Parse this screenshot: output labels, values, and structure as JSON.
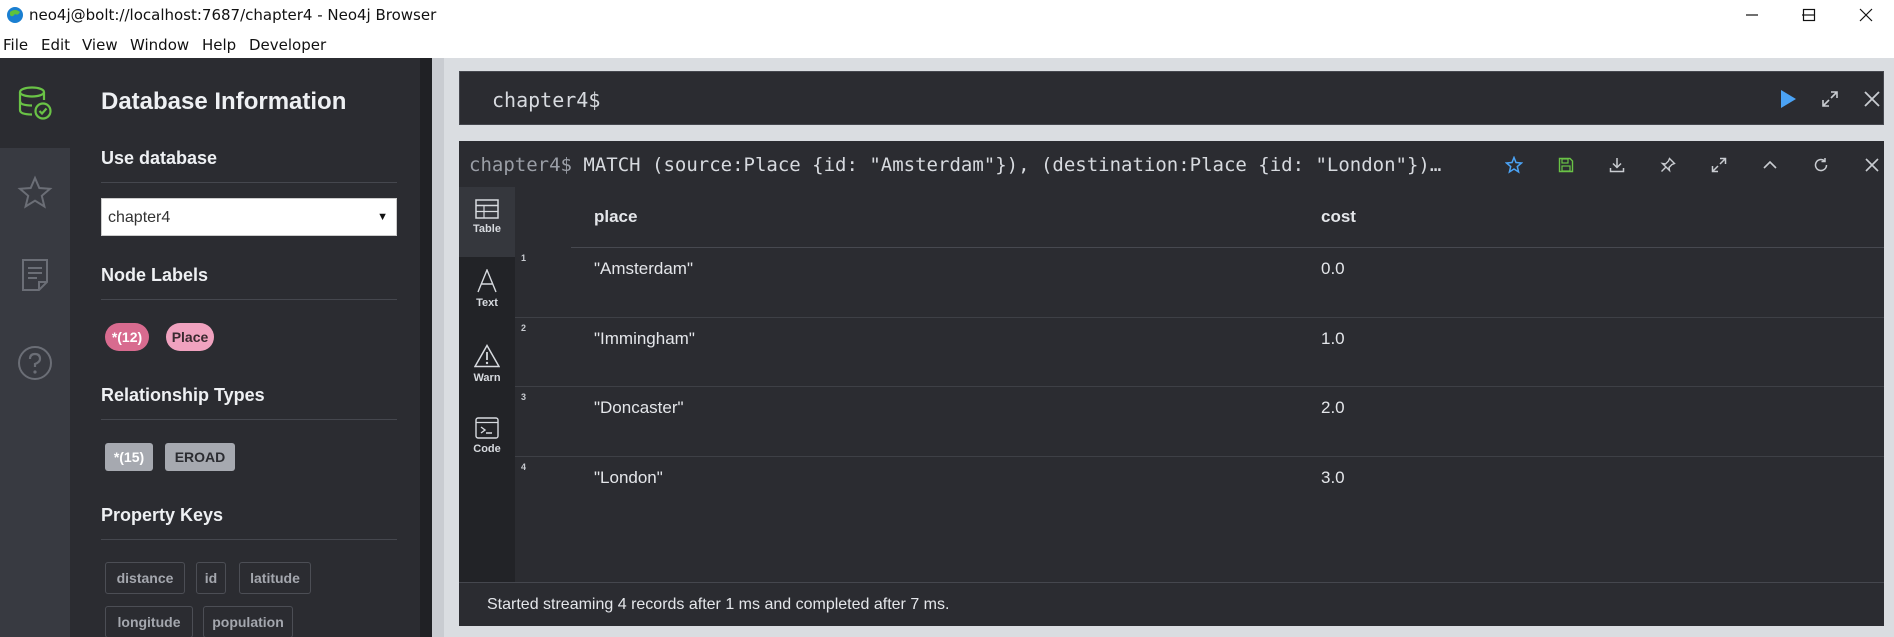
{
  "window": {
    "title": "neo4j@bolt://localhost:7687/chapter4 - Neo4j Browser"
  },
  "menu": [
    "File",
    "Edit",
    "View",
    "Window",
    "Help",
    "Developer"
  ],
  "iconbar": {
    "items": [
      "database-icon",
      "star-icon",
      "document-icon",
      "help-icon"
    ]
  },
  "drawer": {
    "title": "Database Information",
    "use_database": {
      "heading": "Use database",
      "selected": "chapter4"
    },
    "node_labels": {
      "heading": "Node Labels",
      "items": [
        "*(12)",
        "Place"
      ]
    },
    "relationship_types": {
      "heading": "Relationship Types",
      "items": [
        "*(15)",
        "EROAD"
      ]
    },
    "property_keys": {
      "heading": "Property Keys",
      "items": [
        "distance",
        "id",
        "latitude",
        "longitude",
        "population"
      ]
    }
  },
  "editor": {
    "prompt": "chapter4$"
  },
  "frame": {
    "prompt": "chapter4$",
    "query": " MATCH (source:Place {id: \"Amsterdam\"}), (destination:Place {id: \"London\"})…",
    "views": [
      "Table",
      "Text",
      "Warn",
      "Code"
    ],
    "columns": [
      "place",
      "cost"
    ],
    "rows": [
      {
        "num": "1",
        "place": "\"Amsterdam\"",
        "cost": "0.0"
      },
      {
        "num": "2",
        "place": "\"Immingham\"",
        "cost": "1.0"
      },
      {
        "num": "3",
        "place": "\"Doncaster\"",
        "cost": "2.0"
      },
      {
        "num": "4",
        "place": "\"London\"",
        "cost": "3.0"
      }
    ],
    "status": "Started streaming 4 records after 1 ms and completed after 7 ms."
  },
  "colors": {
    "accent_green": "#6ac346",
    "run_blue": "#4ba3f5",
    "node_label_all": "#d86b8f",
    "node_label_place": "#f0a2bf",
    "rel_type": "#a6a9b0"
  }
}
